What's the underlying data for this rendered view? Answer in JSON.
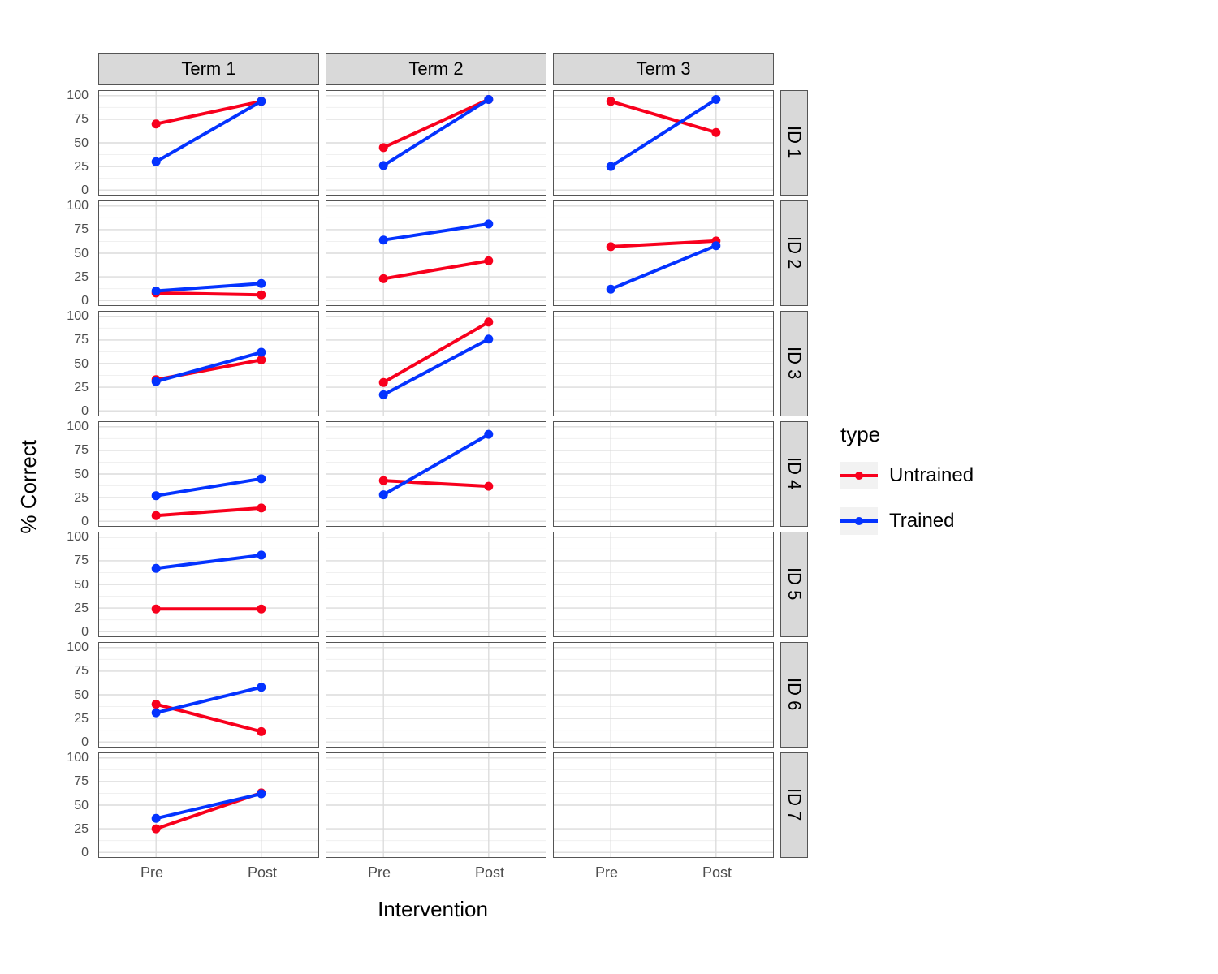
{
  "chart_data": {
    "type": "line",
    "xlabel": "Intervention",
    "ylabel": "% Correct",
    "x_categories": [
      "Pre",
      "Post"
    ],
    "y_ticks": [
      0,
      25,
      50,
      75,
      100
    ],
    "ylim": [
      0,
      100
    ],
    "facet_cols": [
      "Term 1",
      "Term 2",
      "Term 3"
    ],
    "facet_rows": [
      "ID 1",
      "ID 2",
      "ID 3",
      "ID 4",
      "ID 5",
      "ID 6",
      "ID 7"
    ],
    "legend_title": "type",
    "series_meta": [
      {
        "name": "Untrained",
        "color": "#f8001d"
      },
      {
        "name": "Trained",
        "color": "#0433ff"
      }
    ],
    "panels": {
      "ID 1|Term 1": {
        "Untrained": [
          70,
          94
        ],
        "Trained": [
          30,
          94
        ]
      },
      "ID 1|Term 2": {
        "Untrained": [
          45,
          96
        ],
        "Trained": [
          26,
          96
        ]
      },
      "ID 1|Term 3": {
        "Untrained": [
          94,
          61
        ],
        "Trained": [
          25,
          96
        ]
      },
      "ID 2|Term 1": {
        "Untrained": [
          8,
          6
        ],
        "Trained": [
          10,
          18
        ]
      },
      "ID 2|Term 2": {
        "Untrained": [
          23,
          42
        ],
        "Trained": [
          64,
          81
        ]
      },
      "ID 2|Term 3": {
        "Untrained": [
          57,
          63
        ],
        "Trained": [
          12,
          58
        ]
      },
      "ID 3|Term 1": {
        "Untrained": [
          33,
          54
        ],
        "Trained": [
          31,
          62
        ]
      },
      "ID 3|Term 2": {
        "Untrained": [
          30,
          94
        ],
        "Trained": [
          17,
          76
        ]
      },
      "ID 4|Term 1": {
        "Untrained": [
          6,
          14
        ],
        "Trained": [
          27,
          45
        ]
      },
      "ID 4|Term 2": {
        "Untrained": [
          43,
          37
        ],
        "Trained": [
          28,
          92
        ]
      },
      "ID 5|Term 1": {
        "Untrained": [
          24,
          24
        ],
        "Trained": [
          67,
          81
        ]
      },
      "ID 6|Term 1": {
        "Untrained": [
          40,
          11
        ],
        "Trained": [
          31,
          58
        ]
      },
      "ID 7|Term 1": {
        "Untrained": [
          25,
          63
        ],
        "Trained": [
          36,
          62
        ]
      }
    }
  }
}
